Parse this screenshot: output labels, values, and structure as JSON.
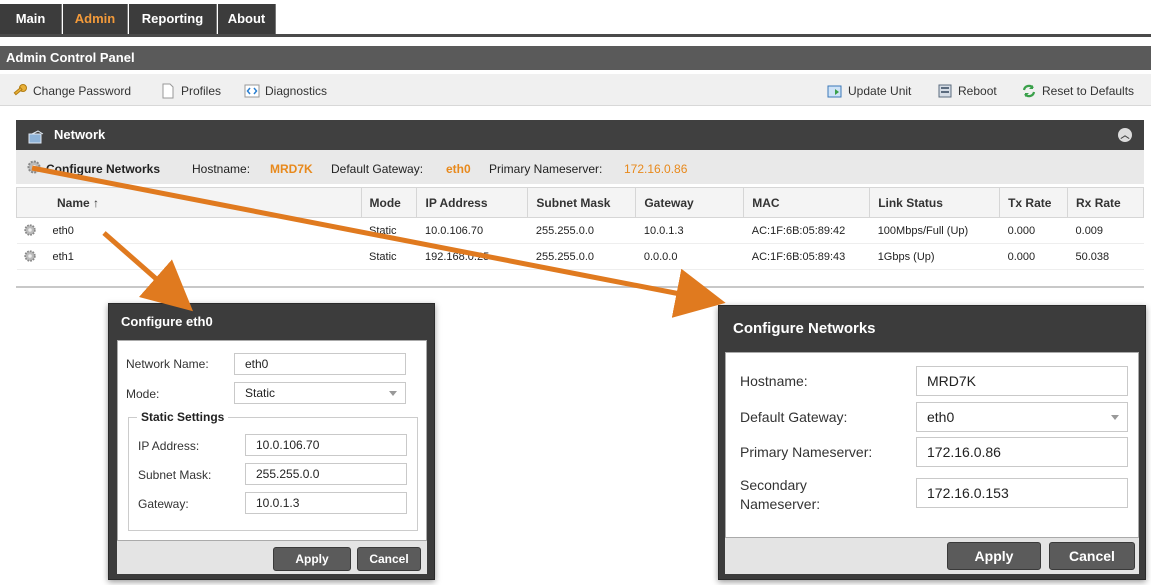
{
  "tabs": [
    "Main",
    "Admin",
    "Reporting",
    "About"
  ],
  "panel_title": "Admin Control Panel",
  "toolbar": {
    "change_password": "Change Password",
    "profiles": "Profiles",
    "diagnostics": "Diagnostics",
    "update_unit": "Update Unit",
    "reboot": "Reboot",
    "reset": "Reset to Defaults"
  },
  "network": {
    "title": "Network",
    "configure_label": "Configure Networks",
    "hostname_label": "Hostname:",
    "hostname": "MRD7K",
    "gateway_label": "Default Gateway:",
    "gateway": "eth0",
    "nameserver_label": "Primary Nameserver:",
    "nameserver": "172.16.0.86",
    "columns": [
      "Name ↑",
      "Mode",
      "IP Address",
      "Subnet Mask",
      "Gateway",
      "MAC",
      "Link Status",
      "Tx Rate",
      "Rx Rate"
    ],
    "rows": [
      [
        "eth0",
        "Static",
        "10.0.106.70",
        "255.255.0.0",
        "10.0.1.3",
        "AC:1F:6B:05:89:42",
        "100Mbps/Full (Up)",
        "0.000",
        "0.009"
      ],
      [
        "eth1",
        "Static",
        "192.168.0.25",
        "255.255.0.0",
        "0.0.0.0",
        "AC:1F:6B:05:89:43",
        "1Gbps (Up)",
        "0.000",
        "50.038"
      ]
    ]
  },
  "dialog_eth0": {
    "title": "Configure eth0",
    "network_name_label": "Network Name:",
    "network_name": "eth0",
    "mode_label": "Mode:",
    "mode": "Static",
    "static_legend": "Static Settings",
    "ip_label": "IP Address:",
    "ip": "10.0.106.70",
    "mask_label": "Subnet Mask:",
    "mask": "255.255.0.0",
    "gw_label": "Gateway:",
    "gw": "10.0.1.3",
    "apply": "Apply",
    "cancel": "Cancel"
  },
  "dialog_networks": {
    "title": "Configure Networks",
    "hostname_label": "Hostname:",
    "hostname": "MRD7K",
    "gateway_label": "Default Gateway:",
    "gateway": "eth0",
    "primary_label": "Primary Nameserver:",
    "primary": "172.16.0.86",
    "secondary_label_1": "Secondary",
    "secondary_label_2": "Nameserver:",
    "secondary": "172.16.0.153",
    "apply": "Apply",
    "cancel": "Cancel"
  },
  "colors": {
    "accent": "#e8891c",
    "arrow": "#e07a1f",
    "dark": "#3c3c3c"
  }
}
